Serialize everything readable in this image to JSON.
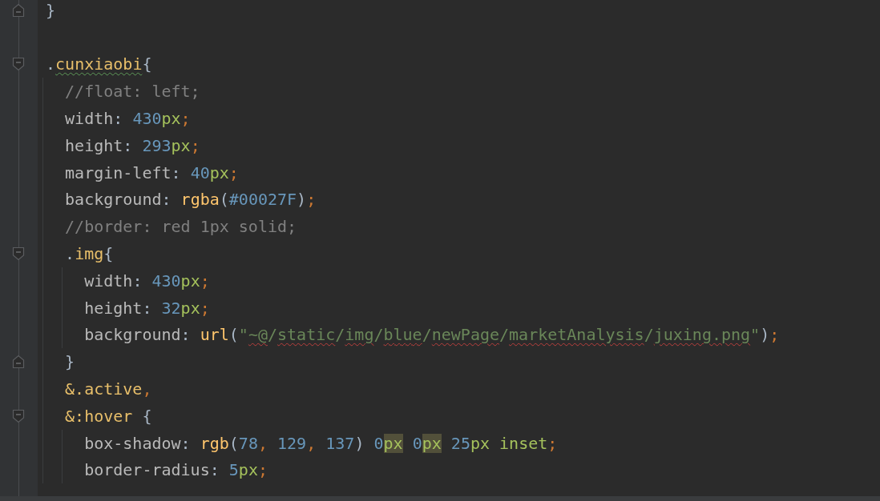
{
  "editor": {
    "lines": [
      {
        "fold_end": true,
        "tokens": [
          {
            "kind": "punct",
            "text": "}"
          }
        ]
      },
      {
        "blank": true
      },
      {
        "fold_start": true,
        "tokens": [
          {
            "kind": "punct",
            "text": "."
          },
          {
            "kind": "selector",
            "text": "cunxiaobi",
            "typo": true
          },
          {
            "kind": "punct",
            "text": "{"
          }
        ]
      },
      {
        "tokens": [
          {
            "kind": "comment",
            "text": "  //float: left;"
          }
        ]
      },
      {
        "tokens": [
          {
            "kind": "property",
            "text": "  width"
          },
          {
            "kind": "punct",
            "text": ": "
          },
          {
            "kind": "number",
            "text": "430"
          },
          {
            "kind": "unit",
            "text": "px"
          },
          {
            "kind": "semi",
            "text": ";"
          }
        ]
      },
      {
        "tokens": [
          {
            "kind": "property",
            "text": "  height"
          },
          {
            "kind": "punct",
            "text": ": "
          },
          {
            "kind": "number",
            "text": "293"
          },
          {
            "kind": "unit",
            "text": "px"
          },
          {
            "kind": "semi",
            "text": ";"
          }
        ]
      },
      {
        "tokens": [
          {
            "kind": "property",
            "text": "  margin-left"
          },
          {
            "kind": "punct",
            "text": ": "
          },
          {
            "kind": "number",
            "text": "40"
          },
          {
            "kind": "unit",
            "text": "px"
          },
          {
            "kind": "semi",
            "text": ";"
          }
        ]
      },
      {
        "tokens": [
          {
            "kind": "property",
            "text": "  background"
          },
          {
            "kind": "punct",
            "text": ": "
          },
          {
            "kind": "function",
            "text": "rgba"
          },
          {
            "kind": "punct",
            "text": "("
          },
          {
            "kind": "number",
            "text": "#00027F"
          },
          {
            "kind": "punct",
            "text": ")"
          },
          {
            "kind": "semi",
            "text": ";"
          }
        ]
      },
      {
        "tokens": [
          {
            "kind": "comment",
            "text": "  //border: red 1px solid;"
          }
        ]
      },
      {
        "fold_start": true,
        "tokens": [
          {
            "kind": "punct",
            "text": "  ."
          },
          {
            "kind": "selector",
            "text": "img"
          },
          {
            "kind": "punct",
            "text": "{"
          }
        ]
      },
      {
        "tokens": [
          {
            "kind": "property",
            "text": "    width"
          },
          {
            "kind": "punct",
            "text": ": "
          },
          {
            "kind": "number",
            "text": "430"
          },
          {
            "kind": "unit",
            "text": "px"
          },
          {
            "kind": "semi",
            "text": ";"
          }
        ]
      },
      {
        "tokens": [
          {
            "kind": "property",
            "text": "    height"
          },
          {
            "kind": "punct",
            "text": ": "
          },
          {
            "kind": "number",
            "text": "32"
          },
          {
            "kind": "unit",
            "text": "px"
          },
          {
            "kind": "semi",
            "text": ";"
          }
        ]
      },
      {
        "tokens": [
          {
            "kind": "property",
            "text": "    background"
          },
          {
            "kind": "punct",
            "text": ": "
          },
          {
            "kind": "function",
            "text": "url"
          },
          {
            "kind": "punct",
            "text": "("
          },
          {
            "kind": "string",
            "text": "\""
          },
          {
            "kind": "string",
            "text": "~@",
            "error": true
          },
          {
            "kind": "string",
            "text": "/"
          },
          {
            "kind": "string",
            "text": "static",
            "error": true
          },
          {
            "kind": "string",
            "text": "/"
          },
          {
            "kind": "string",
            "text": "img",
            "error": true
          },
          {
            "kind": "string",
            "text": "/"
          },
          {
            "kind": "string",
            "text": "blue",
            "error": true
          },
          {
            "kind": "string",
            "text": "/"
          },
          {
            "kind": "string",
            "text": "newPage",
            "error": true
          },
          {
            "kind": "string",
            "text": "/"
          },
          {
            "kind": "string",
            "text": "marketAnalysis",
            "error": true
          },
          {
            "kind": "string",
            "text": "/"
          },
          {
            "kind": "string",
            "text": "juxing.png",
            "error": true
          },
          {
            "kind": "string",
            "text": "\""
          },
          {
            "kind": "punct",
            "text": ")"
          },
          {
            "kind": "semi",
            "text": ";"
          }
        ]
      },
      {
        "fold_end": true,
        "tokens": [
          {
            "kind": "punct",
            "text": "  }"
          }
        ]
      },
      {
        "tokens": [
          {
            "kind": "selector",
            "text": "  &.active"
          },
          {
            "kind": "semi",
            "text": ","
          }
        ]
      },
      {
        "fold_start": true,
        "tokens": [
          {
            "kind": "selector",
            "text": "  &:hover"
          },
          {
            "kind": "punct",
            "text": " {"
          }
        ]
      },
      {
        "tokens": [
          {
            "kind": "property",
            "text": "    box-shadow"
          },
          {
            "kind": "punct",
            "text": ": "
          },
          {
            "kind": "function",
            "text": "rgb"
          },
          {
            "kind": "punct",
            "text": "("
          },
          {
            "kind": "number",
            "text": "78"
          },
          {
            "kind": "semi",
            "text": ", "
          },
          {
            "kind": "number",
            "text": "129"
          },
          {
            "kind": "semi",
            "text": ", "
          },
          {
            "kind": "number",
            "text": "137"
          },
          {
            "kind": "punct",
            "text": ") "
          },
          {
            "kind": "number",
            "text": "0"
          },
          {
            "kind": "unit",
            "text": "px",
            "highlight": true
          },
          {
            "kind": "number",
            "text": " 0"
          },
          {
            "kind": "unit",
            "text": "px",
            "highlight": true
          },
          {
            "kind": "number",
            "text": " 25"
          },
          {
            "kind": "unit",
            "text": "px"
          },
          {
            "kind": "unit",
            "text": " inset"
          },
          {
            "kind": "semi",
            "text": ";"
          }
        ]
      },
      {
        "tokens": [
          {
            "kind": "property",
            "text": "    border-radius"
          },
          {
            "kind": "punct",
            "text": ": "
          },
          {
            "kind": "number",
            "text": "5"
          },
          {
            "kind": "unit",
            "text": "px"
          },
          {
            "kind": "semi",
            "text": ";"
          }
        ]
      }
    ]
  }
}
